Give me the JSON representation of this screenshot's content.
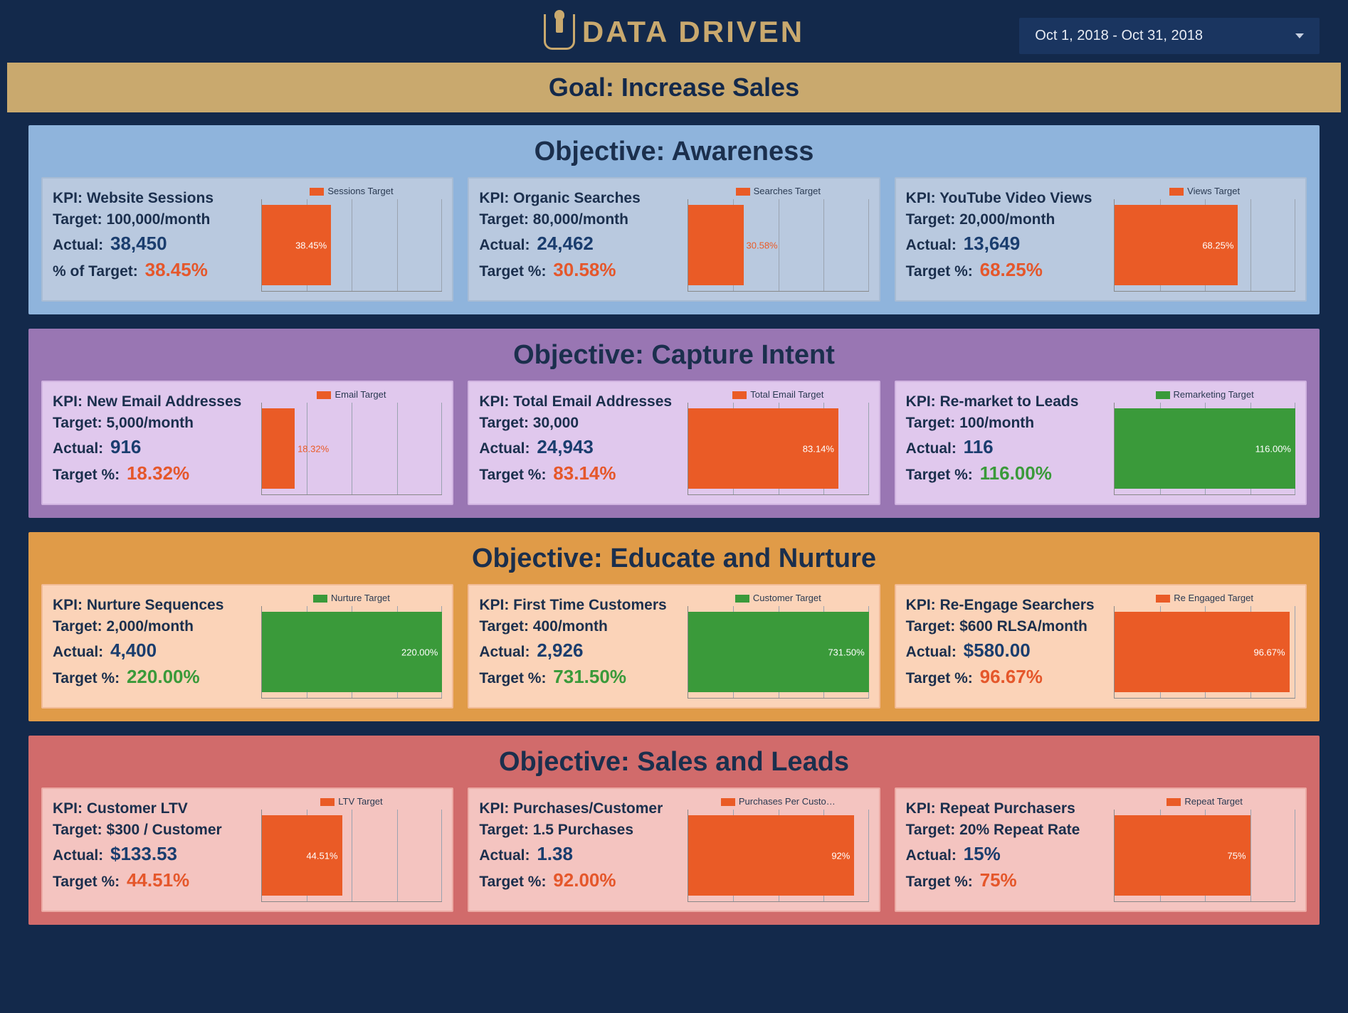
{
  "brand": "DATA DRIVEN",
  "date_range": "Oct 1, 2018 - Oct 31, 2018",
  "goal_banner": "Goal: Increase Sales",
  "labels": {
    "kpi_prefix": "KPI: ",
    "target_prefix": "Target: ",
    "actual_prefix": "Actual:",
    "pct_prefix_a": "% of Target:",
    "pct_prefix_b": "Target %:"
  },
  "objectives": [
    {
      "id": "awareness",
      "title": "Objective: Awareness",
      "css": "obj-awareness",
      "kpis": [
        {
          "name": "Website Sessions",
          "target": "100,000/month",
          "actual": "38,450",
          "pct": "38.45%",
          "pct_color": "red",
          "pct_label": "a",
          "legend": "Sessions Target",
          "bar_color": "orange",
          "bar_pct": 38.45,
          "label_inside": true
        },
        {
          "name": "Organic Searches",
          "target": "80,000/month",
          "actual": "24,462",
          "pct": "30.58%",
          "pct_color": "red",
          "pct_label": "b",
          "legend": "Searches Target",
          "bar_color": "orange",
          "bar_pct": 30.58,
          "label_inside": false
        },
        {
          "name": "YouTube Video Views",
          "target": "20,000/month",
          "actual": "13,649",
          "pct": "68.25%",
          "pct_color": "red",
          "pct_label": "b",
          "legend": "Views Target",
          "bar_color": "orange",
          "bar_pct": 68.25,
          "label_inside": true
        }
      ]
    },
    {
      "id": "capture",
      "title": "Objective: Capture Intent",
      "css": "obj-capture",
      "kpis": [
        {
          "name": "New Email Addresses",
          "target": "5,000/month",
          "actual": "916",
          "pct": "18.32%",
          "pct_color": "red",
          "pct_label": "b",
          "legend": "Email Target",
          "bar_color": "orange",
          "bar_pct": 18.32,
          "label_inside": false
        },
        {
          "name": "Total Email Addresses",
          "target": "30,000",
          "actual": "24,943",
          "pct": "83.14%",
          "pct_color": "red",
          "pct_label": "b",
          "legend": "Total Email Target",
          "bar_color": "orange",
          "bar_pct": 83.14,
          "label_inside": true
        },
        {
          "name": "Re-market to Leads",
          "target": "100/month",
          "actual": "116",
          "pct": "116.00%",
          "pct_color": "green",
          "pct_label": "b",
          "legend": "Remarketing Target",
          "bar_color": "green",
          "bar_pct": 116,
          "label_inside": true
        }
      ]
    },
    {
      "id": "educate",
      "title": "Objective: Educate and Nurture",
      "css": "obj-educate",
      "kpis": [
        {
          "name": "Nurture Sequences",
          "target": "2,000/month",
          "actual": "4,400",
          "pct": "220.00%",
          "pct_color": "green",
          "pct_label": "b",
          "legend": "Nurture Target",
          "bar_color": "green",
          "bar_pct": 220,
          "label_inside": true
        },
        {
          "name": "First Time Customers",
          "target": "400/month",
          "actual": "2,926",
          "pct": "731.50%",
          "pct_color": "green",
          "pct_label": "b",
          "legend": "Customer Target",
          "bar_color": "green",
          "bar_pct": 731.5,
          "label_inside": true
        },
        {
          "name": "Re-Engage Searchers",
          "target": "$600 RLSA/month",
          "actual": "$580.00",
          "pct": "96.67%",
          "pct_color": "red",
          "pct_label": "b",
          "legend": "Re Engaged Target",
          "bar_color": "orange",
          "bar_pct": 96.67,
          "label_inside": true
        }
      ]
    },
    {
      "id": "sales",
      "title": "Objective: Sales and Leads",
      "css": "obj-sales",
      "kpis": [
        {
          "name": "Customer LTV",
          "target": "$300 / Customer",
          "actual": "$133.53",
          "pct": "44.51%",
          "pct_color": "red",
          "pct_label": "b",
          "legend": "LTV Target",
          "bar_color": "orange",
          "bar_pct": 44.51,
          "label_inside": true
        },
        {
          "name": "Purchases/Customer",
          "target": "1.5 Purchases",
          "actual": "1.38",
          "pct": "92.00%",
          "pct_color": "red",
          "pct_label": "b",
          "legend": "Purchases Per Custo…",
          "bar_color": "orange",
          "bar_pct": 92,
          "label_inside": true,
          "pct_display": "92%"
        },
        {
          "name": "Repeat Purchasers",
          "target": "20% Repeat Rate",
          "actual": "15%",
          "pct": "75%",
          "pct_color": "red",
          "pct_label": "b",
          "legend": "Repeat Target",
          "bar_color": "orange",
          "bar_pct": 75,
          "label_inside": true
        }
      ]
    }
  ],
  "chart_data": [
    {
      "type": "bar",
      "title": "Sessions Target",
      "categories": [
        "Website Sessions"
      ],
      "values": [
        38.45
      ],
      "xlabel": "% of Target",
      "ylim": [
        0,
        100
      ]
    },
    {
      "type": "bar",
      "title": "Searches Target",
      "categories": [
        "Organic Searches"
      ],
      "values": [
        30.58
      ],
      "xlabel": "% of Target",
      "ylim": [
        0,
        100
      ]
    },
    {
      "type": "bar",
      "title": "Views Target",
      "categories": [
        "YouTube Video Views"
      ],
      "values": [
        68.25
      ],
      "xlabel": "% of Target",
      "ylim": [
        0,
        100
      ]
    },
    {
      "type": "bar",
      "title": "Email Target",
      "categories": [
        "New Email Addresses"
      ],
      "values": [
        18.32
      ],
      "xlabel": "% of Target",
      "ylim": [
        0,
        100
      ]
    },
    {
      "type": "bar",
      "title": "Total Email Target",
      "categories": [
        "Total Email Addresses"
      ],
      "values": [
        83.14
      ],
      "xlabel": "% of Target",
      "ylim": [
        0,
        100
      ]
    },
    {
      "type": "bar",
      "title": "Remarketing Target",
      "categories": [
        "Re-market to Leads"
      ],
      "values": [
        116.0
      ],
      "xlabel": "% of Target",
      "ylim": [
        0,
        120
      ]
    },
    {
      "type": "bar",
      "title": "Nurture Target",
      "categories": [
        "Nurture Sequences"
      ],
      "values": [
        220.0
      ],
      "xlabel": "% of Target",
      "ylim": [
        0,
        250
      ]
    },
    {
      "type": "bar",
      "title": "Customer Target",
      "categories": [
        "First Time Customers"
      ],
      "values": [
        731.5
      ],
      "xlabel": "% of Target",
      "ylim": [
        0,
        800
      ]
    },
    {
      "type": "bar",
      "title": "Re Engaged Target",
      "categories": [
        "Re-Engage Searchers"
      ],
      "values": [
        96.67
      ],
      "xlabel": "% of Target",
      "ylim": [
        0,
        100
      ]
    },
    {
      "type": "bar",
      "title": "LTV Target",
      "categories": [
        "Customer LTV"
      ],
      "values": [
        44.51
      ],
      "xlabel": "% of Target",
      "ylim": [
        0,
        100
      ]
    },
    {
      "type": "bar",
      "title": "Purchases Per Customer Target",
      "categories": [
        "Purchases/Customer"
      ],
      "values": [
        92.0
      ],
      "xlabel": "% of Target",
      "ylim": [
        0,
        100
      ]
    },
    {
      "type": "bar",
      "title": "Repeat Target",
      "categories": [
        "Repeat Purchasers"
      ],
      "values": [
        75.0
      ],
      "xlabel": "% of Target",
      "ylim": [
        0,
        100
      ]
    }
  ]
}
